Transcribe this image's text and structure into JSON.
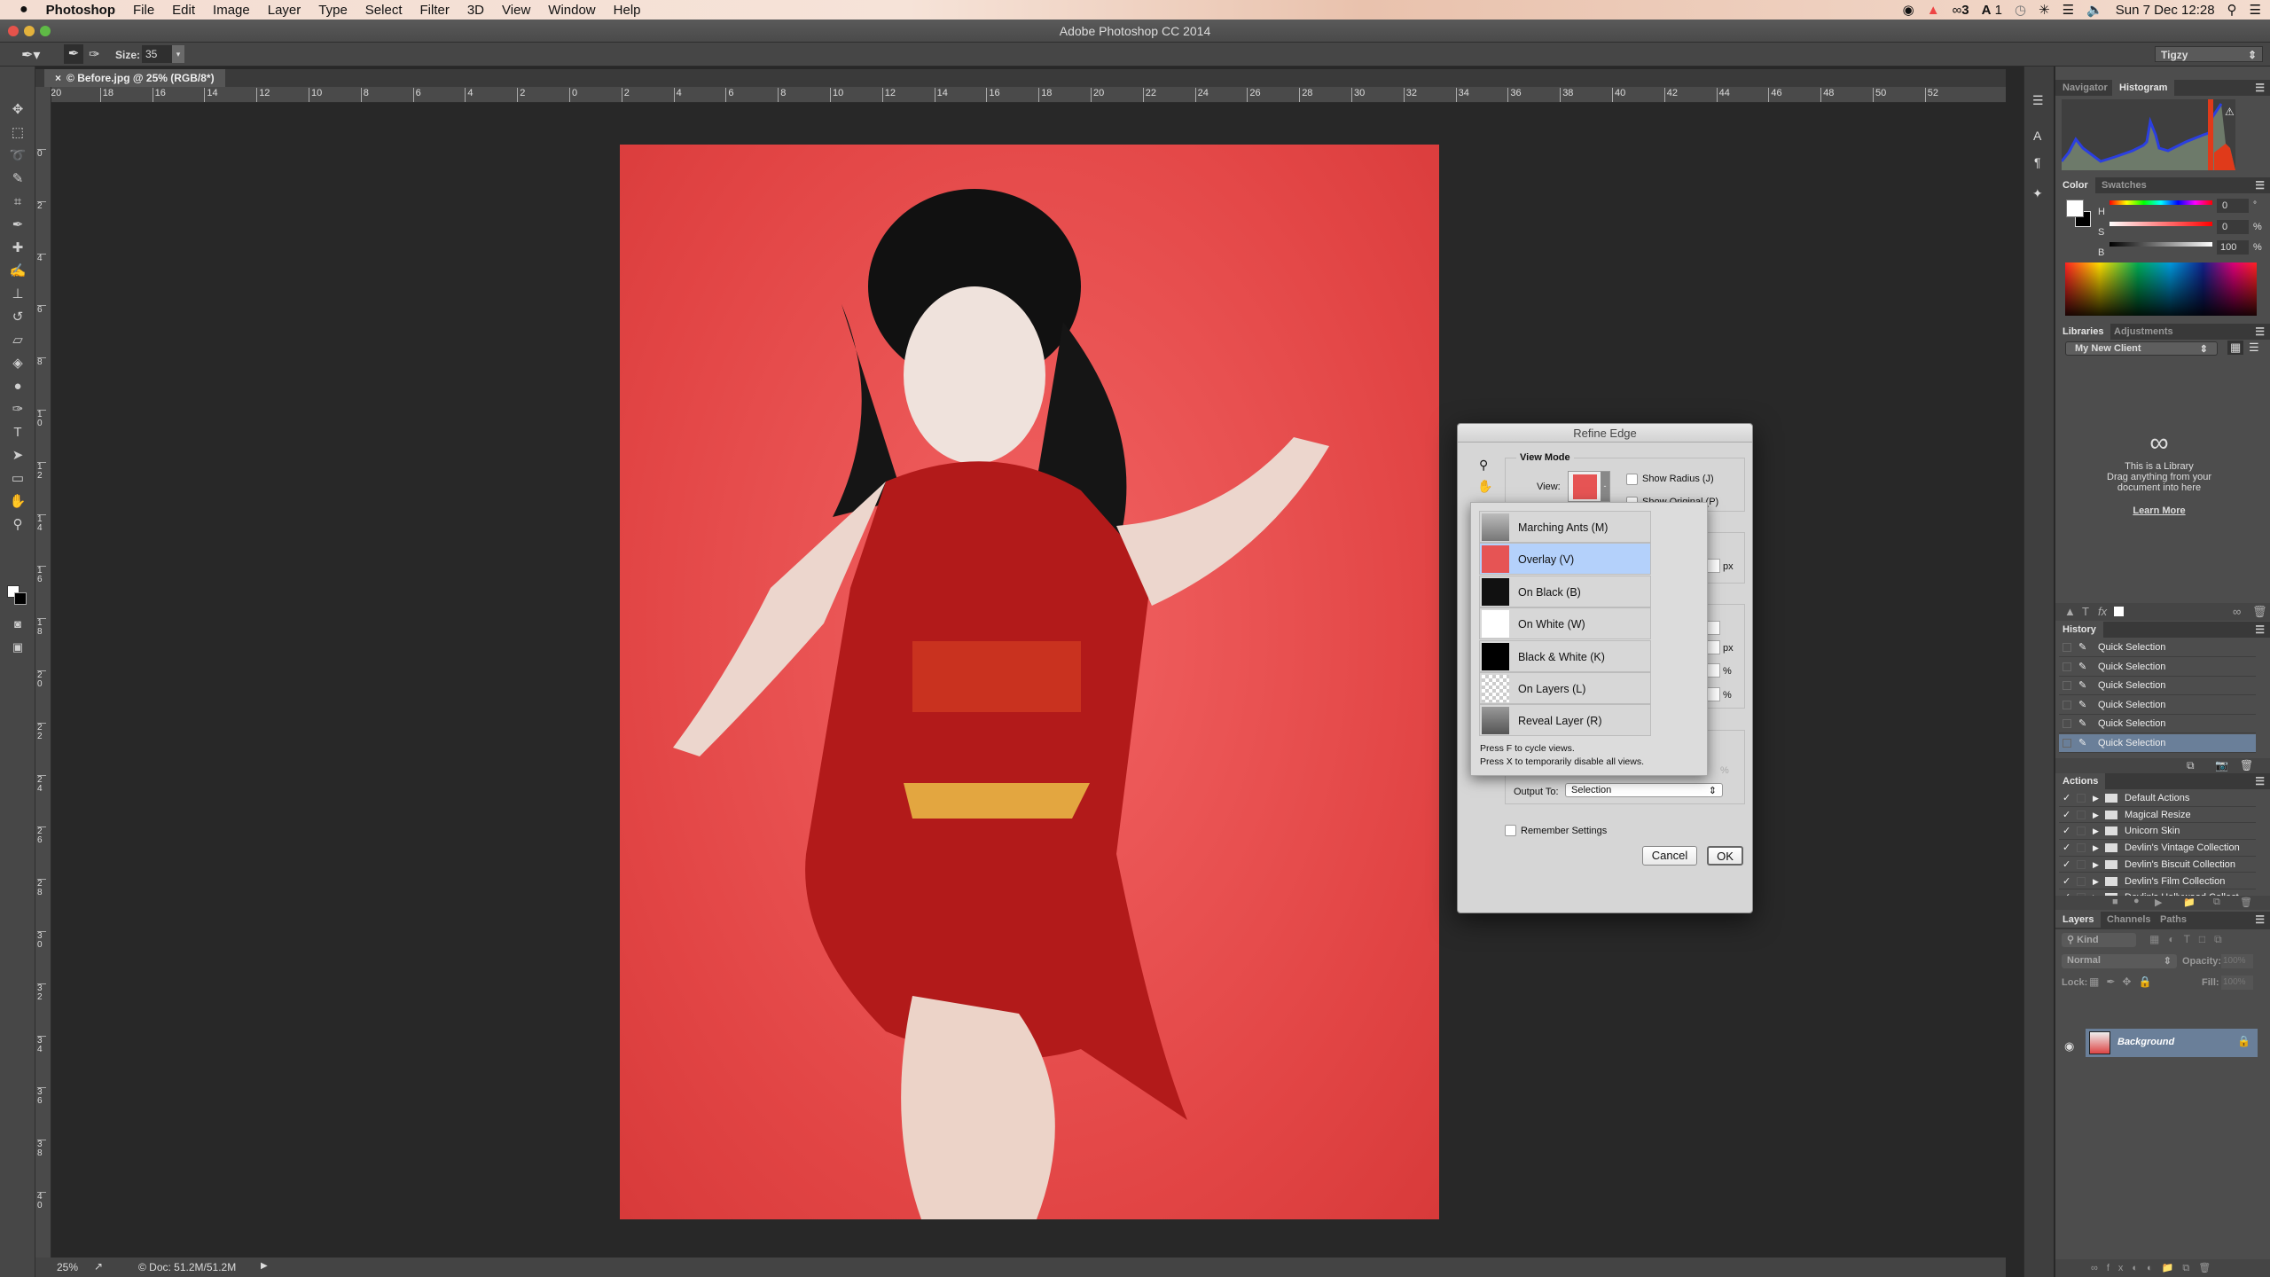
{
  "menubar": {
    "apple": "",
    "app": "Photoshop",
    "items": [
      "File",
      "Edit",
      "Image",
      "Layer",
      "Type",
      "Select",
      "Filter",
      "3D",
      "View",
      "Window",
      "Help"
    ],
    "status": {
      "cc_count": "3",
      "adobe_count": "1",
      "datetime": "Sun 7 Dec  12:28"
    }
  },
  "window": {
    "title": "Adobe Photoshop CC 2014"
  },
  "options": {
    "size_label": "Size:",
    "size_value": "35",
    "workspace": "Tigzy"
  },
  "tools": [
    "move",
    "marquee",
    "lasso",
    "quick-selection",
    "crop",
    "eyedropper",
    "healing-brush",
    "brush",
    "clone-stamp",
    "history-brush",
    "eraser",
    "paint-bucket",
    "dodge",
    "pen",
    "type",
    "path-selection",
    "rectangle",
    "hand",
    "zoom"
  ],
  "document": {
    "tab": "© Before.jpg @ 25% (RGB/8*)",
    "zoom": "25%",
    "doc_info": "© Doc: 51.2M/51.2M"
  },
  "rulers": {
    "horizontal": [
      "20",
      "18",
      "16",
      "14",
      "12",
      "10",
      "8",
      "6",
      "4",
      "2",
      "0",
      "2",
      "4",
      "6",
      "8",
      "10",
      "12",
      "14",
      "16",
      "18",
      "20",
      "22",
      "24",
      "26",
      "28",
      "30",
      "32",
      "34",
      "36",
      "38",
      "40",
      "42",
      "44",
      "46",
      "48",
      "50",
      "52"
    ],
    "vertical": [
      "0",
      "2",
      "4",
      "6",
      "8",
      "10",
      "12",
      "14",
      "16",
      "18",
      "20",
      "22",
      "24",
      "26",
      "28",
      "30",
      "32",
      "34",
      "36",
      "38",
      "40"
    ]
  },
  "panels": {
    "navigator": {
      "tabs": [
        "Navigator",
        "Histogram"
      ],
      "active": "Histogram"
    },
    "color": {
      "tabs": [
        "Color",
        "Swatches"
      ],
      "active": "Color",
      "h_label": "H",
      "s_label": "S",
      "b_label": "B",
      "h": "0",
      "s": "0",
      "b": "100",
      "h_unit": "°",
      "s_unit": "%",
      "b_unit": "%",
      "foreground": "#ffffff",
      "background": "#000000"
    },
    "libraries": {
      "tabs": [
        "Libraries",
        "Adjustments"
      ],
      "active": "Libraries",
      "library": "My New Client",
      "empty_line1": "This is a Library",
      "empty_line2": "Drag anything from your",
      "empty_line3": "document into here",
      "learn_more": "Learn More"
    },
    "history": {
      "title": "History",
      "items": [
        "Quick Selection",
        "Quick Selection",
        "Quick Selection",
        "Quick Selection",
        "Quick Selection",
        "Quick Selection"
      ],
      "selected_index": 5
    },
    "actions": {
      "title": "Actions",
      "items": [
        "Default Actions",
        "Magical Resize",
        "Unicorn Skin",
        "Devlin's Vintage Collection",
        "Devlin's Biscuit Collection",
        "Devlin's Film Collection",
        "Devlin's Hollywood Collect..."
      ]
    },
    "layers": {
      "tabs": [
        "Layers",
        "Channels",
        "Paths"
      ],
      "active": "Layers",
      "filter": "Kind",
      "blend": "Normal",
      "opacity_label": "Opacity:",
      "opacity": "100%",
      "lock_label": "Lock:",
      "fill_label": "Fill:",
      "fill": "100%",
      "layer_name": "Background"
    }
  },
  "dialog": {
    "title": "Refine Edge",
    "view_mode_label": "View Mode",
    "view_label": "View:",
    "show_radius": "Show Radius (J)",
    "show_original": "Show Original (P)",
    "view_options": [
      "Marching Ants (M)",
      "Overlay (V)",
      "On Black (B)",
      "On White (W)",
      "Black & White (K)",
      "On Layers (L)",
      "Reveal Layer (R)"
    ],
    "selected_view": "Overlay (V)",
    "hint1": "Press F to cycle views.",
    "hint2": "Press X to temporarily disable all views.",
    "px": "px",
    "percent": "%",
    "output_label": "Output To:",
    "output_value": "Selection",
    "remember": "Remember Settings",
    "cancel": "Cancel",
    "ok": "OK"
  },
  "colors": {
    "canvas": "#282828",
    "panel": "#4d4d4d",
    "selection_highlight": "#b4d1fb",
    "history_selected": "#6a7f99",
    "backdrop": "#e24545"
  }
}
